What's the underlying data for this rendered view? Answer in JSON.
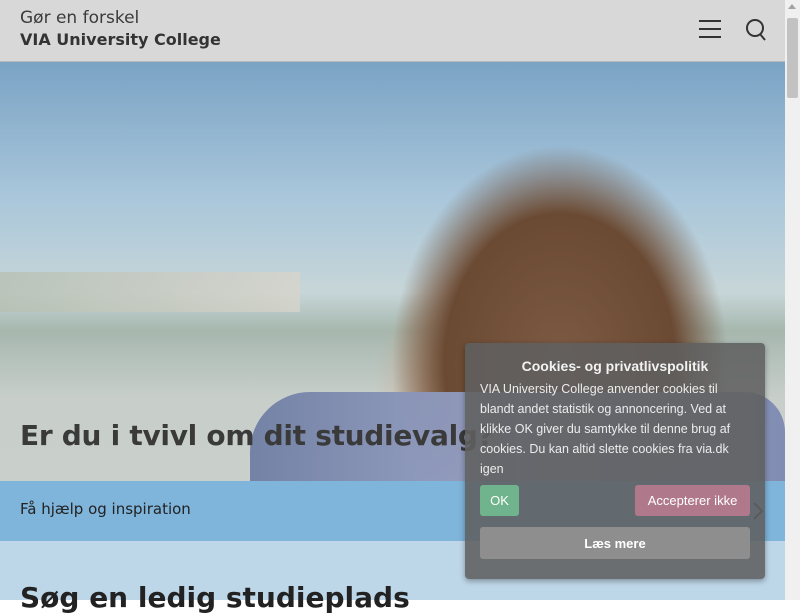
{
  "header": {
    "tagline": "Gør en forskel",
    "brand": "VIA University College"
  },
  "hero": {
    "title": "Er du i tvivl om dit studievalg?",
    "link_label": "Få hjælp og inspiration"
  },
  "section": {
    "title": "Søg en ledig studieplads"
  },
  "cookie_banner": {
    "title": "Cookies- og privatlivspolitik",
    "text": "VIA University College anvender cookies til blandt andet statistik og annoncering. Ved at klikke OK giver du samtykke til denne brug af cookies. Du kan altid slette cookies fra via.dk igen",
    "ok_label": "OK",
    "reject_label": "Accepterer ikke",
    "more_label": "Læs mere"
  },
  "icons": {
    "menu": "hamburger-menu-icon",
    "search": "search-icon",
    "chevron": "chevron-right-icon"
  },
  "colors": {
    "header_bg": "#d8d8d8",
    "hero_bar": "#7fb4db",
    "ok_button": "#6fb48c",
    "reject_button": "#b0798b",
    "more_button": "#8e8e8e"
  }
}
